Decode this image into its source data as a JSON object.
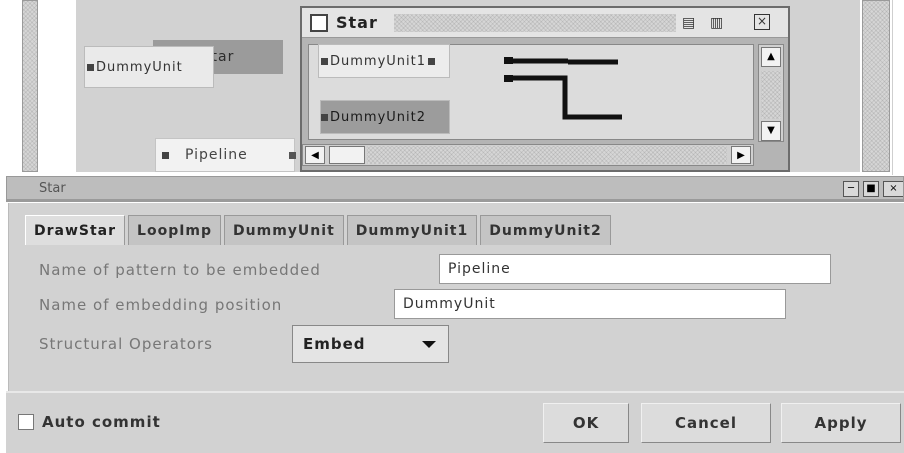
{
  "canvas": {
    "star_node_label": "Star",
    "pipeline_node_label": "Pipeline"
  },
  "star_window": {
    "title": "Star",
    "units": {
      "main": "DummyUnit",
      "unit1": "DummyUnit1",
      "unit2": "DummyUnit2"
    }
  },
  "props_window": {
    "title": "Star",
    "tabs": [
      "DrawStar",
      "LoopImp",
      "DummyUnit",
      "DummyUnit1",
      "DummyUnit2"
    ],
    "active_tab": "DrawStar",
    "fields": {
      "pattern_label": "Name of pattern to be embedded",
      "pattern_value": "Pipeline",
      "position_label": "Name of embedding position",
      "position_value": "DummyUnit",
      "operators_label": "Structural Operators",
      "operators_value": "Embed"
    }
  },
  "footer": {
    "auto_commit_label": "Auto commit",
    "ok_label": "OK",
    "cancel_label": "Cancel",
    "apply_label": "Apply"
  },
  "colors": {
    "window_bg": "#d2d2d2",
    "title_bar": "#bdbdbd",
    "selected_node": "#9b9b9b"
  }
}
